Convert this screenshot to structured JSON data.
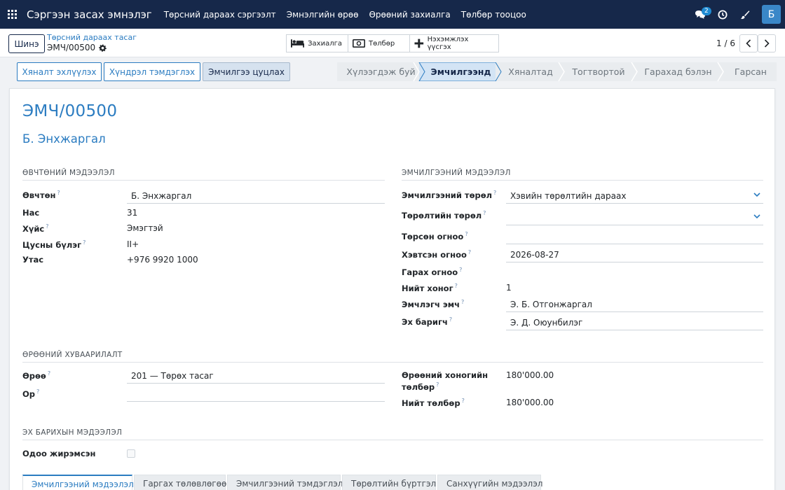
{
  "topbar": {
    "app_title": "Сэргээн засах эмнэлэг",
    "menu": [
      "Төрсний дараах сэргээлт",
      "Эмнэлгийн өрөө",
      "Өрөөний захиалга",
      "Төлбөр тооцоо"
    ],
    "chat_count": "2",
    "user_initial": "Б"
  },
  "control": {
    "new_label": "Шинэ",
    "breadcrumb_parent": "Төрсний дараах тасаг",
    "breadcrumb_current": "ЭМЧ/00500",
    "smart_buttons": [
      "Захиалга",
      "Төлбөр",
      "Нэхэмжлэх үүсгэх"
    ],
    "pager": "1 / 6"
  },
  "header": {
    "actions": [
      "Хяналт эхлүүлэх",
      "Хүндрэл тэмдэглэх",
      "Эмчилгээ цуцлах"
    ],
    "stages": [
      "Хүлээгдэж буй",
      "Эмчилгээнд",
      "Хяналтад",
      "Тогтвортой",
      "Гарахад бэлэн",
      "Гарсан"
    ],
    "active_stage": "Эмчилгээнд"
  },
  "record": {
    "reference": "ЭМЧ/00500",
    "patient_name": "Б. Энхжаргал"
  },
  "patient_info": {
    "title": "ӨВЧТӨНИЙ МЭДЭЭЛЭЛ",
    "patient_label": "Өвчтөн",
    "patient_value": "Б. Энхжаргал",
    "age_label": "Нас",
    "age_value": "31",
    "gender_label": "Хүйс",
    "gender_value": "Эмэгтэй",
    "blood_label": "Цусны бүлэг",
    "blood_value": "II+",
    "phone_label": "Утас",
    "phone_value": "+976 9920 1000"
  },
  "treatment_info": {
    "title": "ЭМЧИЛГЭЭНИЙ МЭДЭЭЛЭЛ",
    "type_label": "Эмчилгээний төрөл",
    "type_value": "Хэвийн төрөлтийн дараах",
    "birth_type_label": "Төрөлтийн төрөл",
    "birth_type_value": "",
    "birth_date_label": "Төрсөн огноо",
    "birth_date_value": "",
    "admit_date_label": "Хэвтсэн огноо",
    "admit_date_value": "2026-08-27",
    "discharge_date_label": "Гарах огноо",
    "discharge_date_value": "",
    "days_label": "Нийт хоног",
    "days_value": "1",
    "doctor_label": "Эмчлэгч эмч",
    "doctor_value": "Э. Б. Отгонжаргал",
    "midwife_label": "Эх баригч",
    "midwife_value": "Э. Д. Оюунбилэг"
  },
  "room_alloc": {
    "title": "ӨРӨӨНИЙ ХУВААРИЛАЛТ",
    "room_label": "Өрөө",
    "room_value": "201 — Төрөх тасаг",
    "bed_label": "Ор",
    "bed_value": "",
    "daily_fee_label": "Өрөөний хоногийн",
    "daily_fee_label2": "төлбөр",
    "daily_fee_value": "180'000.00",
    "total_fee_label": "Нийт төлбөр",
    "total_fee_value": "180'000.00"
  },
  "midwife_info": {
    "title": "ЭХ БАРИХЫН МЭДЭЭЛЭЛ",
    "active_label": "Одоо жирэмсэн",
    "active_value": false
  },
  "tabs": [
    "Эмчилгээний мэдээлэл",
    "Гаргах төлөвлөгөө",
    "Эмчилгээний тэмдэглэл",
    "Төрөлтийн бүртгэл",
    "Санхүүгийн мэдээлэл"
  ],
  "colors": {
    "navbar": "#16284a",
    "accent": "#2b7cc1",
    "active_stage": "#d3e4f5"
  }
}
